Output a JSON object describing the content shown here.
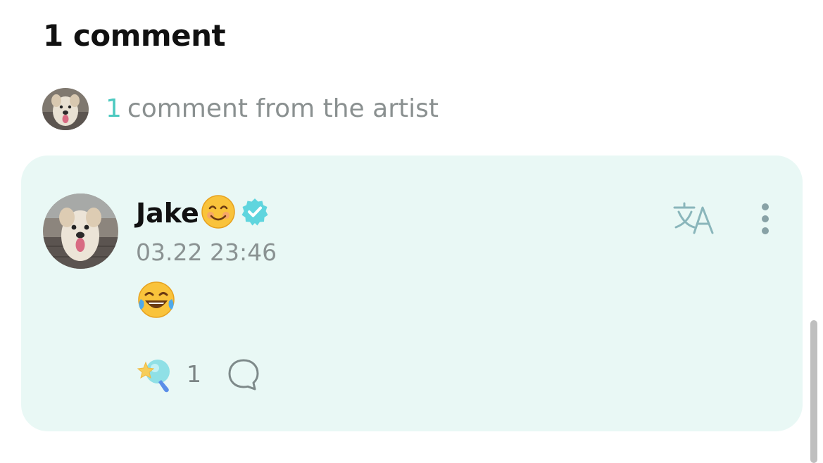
{
  "header": {
    "title": "1 comment"
  },
  "artist_summary": {
    "count": "1",
    "label": "comment from the artist",
    "avatar_icon": "dog-avatar-icon"
  },
  "comment": {
    "author": "Jake",
    "author_emoji": "smile-emoji-icon",
    "verified_icon": "verified-badge-icon",
    "timestamp": "03.22 23:46",
    "body_emoji": "tears-of-joy-emoji-icon",
    "reaction_count": "1",
    "actions": {
      "translate_icon": "translate-icon",
      "more_icon": "more-vertical-icon",
      "reaction_icon": "reaction-star-icon",
      "reply_icon": "reply-bubble-icon"
    }
  },
  "colors": {
    "accent": "#4cc9c0",
    "card_background": "#e9f8f5",
    "muted_text": "#8a9292",
    "verified": "#5fd5de"
  }
}
